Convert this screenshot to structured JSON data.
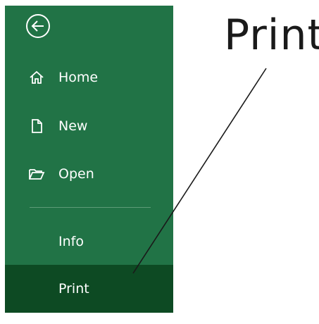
{
  "backstage": {
    "accent_color": "#217346",
    "selected_color": "#0d4a23",
    "back_button": {
      "icon": "back-arrow-circle-icon"
    },
    "items": [
      {
        "label": "Home",
        "icon": "home-icon"
      },
      {
        "label": "New",
        "icon": "new-document-icon"
      },
      {
        "label": "Open",
        "icon": "open-folder-icon"
      },
      {
        "label": "Info",
        "icon": ""
      },
      {
        "label": "Print",
        "icon": "",
        "selected": true
      }
    ]
  },
  "callout": {
    "text": "Print"
  }
}
